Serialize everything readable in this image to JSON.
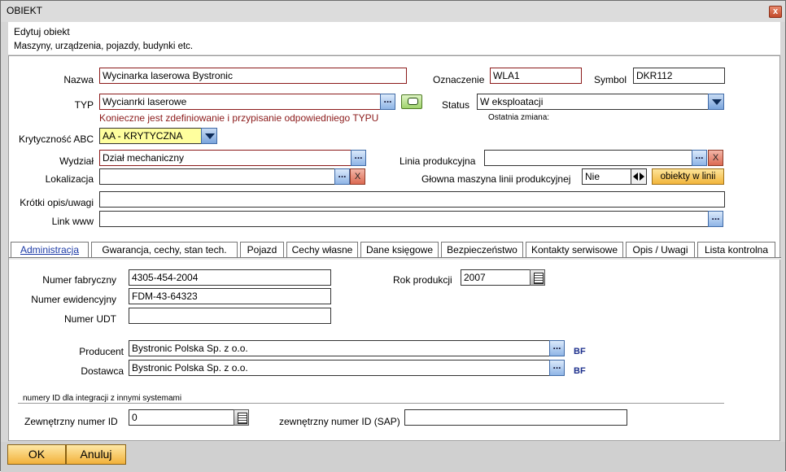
{
  "window": {
    "title": "OBIEKT",
    "close": "x"
  },
  "header": {
    "line1": "Edytuj obiekt",
    "line2": "Maszyny, urządzenia, pojazdy, budynki etc."
  },
  "form": {
    "nazwa_label": "Nazwa",
    "nazwa_value": "Wycinarka laserowa Bystronic",
    "oznaczenie_label": "Oznaczenie",
    "oznaczenie_value": "WLA1",
    "symbol_label": "Symbol",
    "symbol_value": "DKR112",
    "typ_label": "TYP",
    "typ_value": "Wycianrki laserowe",
    "typ_warning": "Konieczne jest zdefiniowanie i przypisanie odpowiedniego TYPU",
    "status_label": "Status",
    "status_value": "W eksploatacji",
    "ostatnia_zmiana_label": "Ostatnia zmiana:",
    "krytycznosc_label": "Krytyczność ABC",
    "krytycznosc_value": "AA - KRYTYCZNA",
    "wydzial_label": "Wydział",
    "wydzial_value": "Dział mechaniczny",
    "linia_label": "Linia produkcyjna",
    "linia_value": "",
    "lokalizacja_label": "Lokalizacja",
    "lokalizacja_value": "",
    "glowna_label": "Głowna maszyna linii produkcyjnej",
    "glowna_value": "Nie",
    "obiekty_btn": "obiekty w linii",
    "opis_label": "Krótki opis/uwagi",
    "opis_value": "",
    "link_label": "Link www",
    "link_value": "",
    "dots": "...",
    "x": "X"
  },
  "tabs": [
    "Administracja",
    "Gwarancja, cechy, stan tech.",
    "Pojazd",
    "Cechy własne",
    "Dane księgowe",
    "Bezpieczeństwo",
    "Kontakty serwisowe",
    "Opis / Uwagi",
    "Lista kontrolna"
  ],
  "admin": {
    "nr_fabryczny_label": "Numer fabryczny",
    "nr_fabryczny_value": "4305-454-2004",
    "nr_ewid_label": "Numer ewidencyjny",
    "nr_ewid_value": "FDM-43-64323",
    "nr_udt_label": "Numer UDT",
    "nr_udt_value": "",
    "rok_label": "Rok produkcji",
    "rok_value": "2007",
    "producent_label": "Producent",
    "producent_value": "Bystronic Polska Sp. z o.o.",
    "dostawca_label": "Dostawca",
    "dostawca_value": "Bystronic Polska Sp. z o.o.",
    "bf": "BF",
    "integracja_label": "numery ID dla integracji z innymi systemami",
    "zew_id_label": "Zewnętrzny numer ID",
    "zew_id_value": "0",
    "zew_sap_label": "zewnętrzny numer ID (SAP)",
    "zew_sap_value": ""
  },
  "footer": {
    "ok": "OK",
    "cancel": "Anuluj"
  }
}
